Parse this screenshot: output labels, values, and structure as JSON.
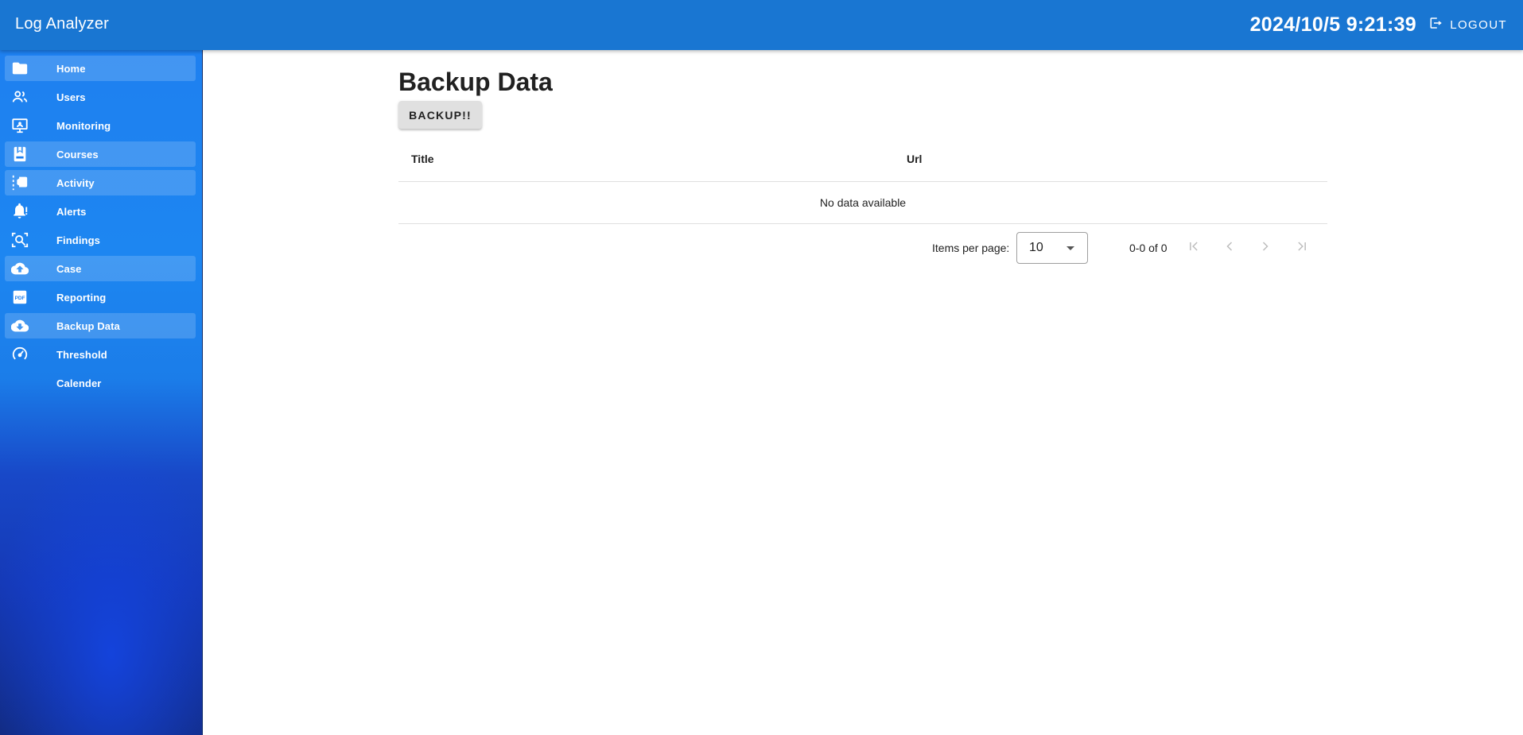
{
  "app": {
    "title": "Log Analyzer",
    "datetime": "2024/10/5 9:21:39",
    "logout_label": "LOGOUT"
  },
  "colors": {
    "appbar": "#1976d2",
    "sidebar_top": "#1e80f0",
    "sidebar_bottom": "#122b82",
    "button_bg": "#e0e0e0"
  },
  "sidebar": {
    "items": [
      {
        "label": "Home",
        "icon": "folder-icon"
      },
      {
        "label": "Users",
        "icon": "users-icon"
      },
      {
        "label": "Monitoring",
        "icon": "monitor-icon"
      },
      {
        "label": "Courses",
        "icon": "courses-icon"
      },
      {
        "label": "Activity",
        "icon": "activity-icon"
      },
      {
        "label": "Alerts",
        "icon": "bell-alert-icon"
      },
      {
        "label": "Findings",
        "icon": "search-image-icon"
      },
      {
        "label": "Case",
        "icon": "cloud-upload-icon"
      },
      {
        "label": "Reporting",
        "icon": "pdf-icon"
      },
      {
        "label": "Backup Data",
        "icon": "cloud-download-icon"
      },
      {
        "label": "Threshold",
        "icon": "speedometer-icon"
      },
      {
        "label": "Calender",
        "icon": ""
      }
    ]
  },
  "main": {
    "page_title": "Backup Data",
    "backup_button": "BACKUP!!",
    "table": {
      "headers": [
        "Title",
        "Url"
      ],
      "empty_text": "No data available"
    },
    "pagination": {
      "items_per_page_label": "Items per page:",
      "items_per_page_value": "10",
      "range_text": "0-0 of 0"
    }
  }
}
